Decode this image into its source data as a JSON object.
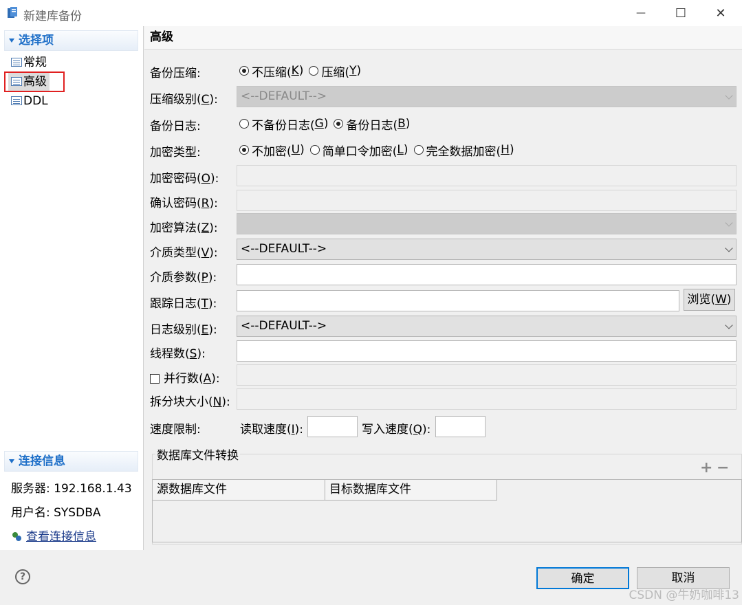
{
  "window": {
    "title": "新建库备份",
    "minimize": "—",
    "maximize": "☐",
    "close": "✕"
  },
  "sidebar": {
    "options_title": "选择项",
    "items": [
      "常规",
      "高级",
      "DDL"
    ],
    "connection_title": "连接信息",
    "server": "服务器: 192.168.1.43",
    "user": "用户名: SYSDBA",
    "view_link": "查看连接信息"
  },
  "main": {
    "title": "高级",
    "compress": {
      "label": "备份压缩:",
      "options": [
        {
          "text": "不压缩(",
          "key": "K",
          "selected": true
        },
        {
          "text": "压缩(",
          "key": "Y",
          "selected": false
        }
      ]
    },
    "compress_level": {
      "label_pre": "压缩级别(",
      "key": "C",
      "label_post": "):",
      "value": "<--DEFAULT-->"
    },
    "backup_log": {
      "label": "备份日志:",
      "options": [
        {
          "text": "不备份日志(",
          "key": "G",
          "selected": false
        },
        {
          "text": "备份日志(",
          "key": "B",
          "selected": true
        }
      ]
    },
    "encrypt_type": {
      "label": "加密类型:",
      "options": [
        {
          "text": "不加密(",
          "key": "U",
          "selected": true
        },
        {
          "text": "简单口令加密(",
          "key": "L",
          "selected": false
        },
        {
          "text": "完全数据加密(",
          "key": "H",
          "selected": false
        }
      ]
    },
    "encrypt_password": {
      "label_pre": "加密密码(",
      "key": "O",
      "label_post": "):",
      "value": ""
    },
    "confirm_password": {
      "label_pre": "确认密码(",
      "key": "R",
      "label_post": "):",
      "value": ""
    },
    "encrypt_algo": {
      "label_pre": "加密算法(",
      "key": "Z",
      "label_post": "):",
      "value": ""
    },
    "media_type": {
      "label_pre": "介质类型(",
      "key": "V",
      "label_post": "):",
      "value": "<--DEFAULT-->"
    },
    "media_param": {
      "label_pre": "介质参数(",
      "key": "P",
      "label_post": "):",
      "value": ""
    },
    "trace_log": {
      "label_pre": "跟踪日志(",
      "key": "T",
      "label_post": "):",
      "value": "",
      "browse_pre": "浏览(",
      "browse_key": "W",
      "browse_post": ")"
    },
    "log_level": {
      "label_pre": "日志级别(",
      "key": "E",
      "label_post": "):",
      "value": "<--DEFAULT-->"
    },
    "threads": {
      "label_pre": "线程数(",
      "key": "S",
      "label_post": "):",
      "value": ""
    },
    "parallel": {
      "label_pre": "并行数(",
      "key": "A",
      "label_post": "):",
      "checked": false,
      "value": ""
    },
    "split_size": {
      "label_pre": "拆分块大小(",
      "key": "N",
      "label_post": "):",
      "value": ""
    },
    "speed": {
      "label": "速度限制:",
      "read_pre": "读取速度(",
      "read_key": "I",
      "read_post": "):",
      "read_value": "",
      "write_pre": "写入速度(",
      "write_key": "Q",
      "write_post": "):",
      "write_value": ""
    },
    "file_convert": {
      "title": "数据库文件转换",
      "add": "+",
      "remove": "−",
      "columns": [
        "源数据库文件",
        "目标数据库文件"
      ]
    }
  },
  "footer": {
    "help": "?",
    "ok": "确定",
    "cancel": "取消",
    "watermark": "CSDN @牛奶咖啡13"
  }
}
